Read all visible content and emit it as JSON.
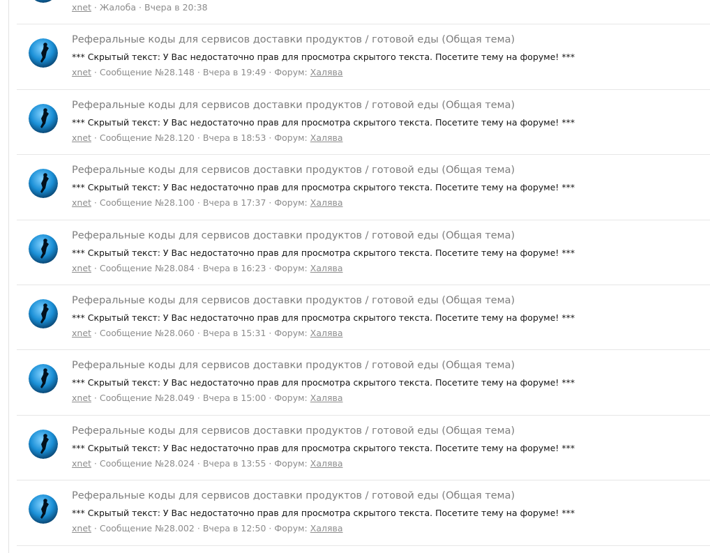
{
  "top_item": {
    "author": "xnet",
    "type": "Жалоба",
    "time": "Вчера в 20:38"
  },
  "labels": {
    "message_prefix": "Сообщение №",
    "forum_prefix": "Форум:"
  },
  "posts": [
    {
      "title": "Реферальные коды для сервисов доставки продуктов / готовой еды (Общая тема)",
      "snippet": "*** Скрытый текст: У Вас недостаточно прав для просмотра скрытого текста. Посетите тему на форуме! ***",
      "author": "xnet",
      "message_num": "28.148",
      "time": "Вчера в 19:49",
      "forum": "Халява"
    },
    {
      "title": "Реферальные коды для сервисов доставки продуктов / готовой еды (Общая тема)",
      "snippet": "*** Скрытый текст: У Вас недостаточно прав для просмотра скрытого текста. Посетите тему на форуме! ***",
      "author": "xnet",
      "message_num": "28.120",
      "time": "Вчера в 18:53",
      "forum": "Халява"
    },
    {
      "title": "Реферальные коды для сервисов доставки продуктов / готовой еды (Общая тема)",
      "snippet": "*** Скрытый текст: У Вас недостаточно прав для просмотра скрытого текста. Посетите тему на форуме! ***",
      "author": "xnet",
      "message_num": "28.100",
      "time": "Вчера в 17:37",
      "forum": "Халява"
    },
    {
      "title": "Реферальные коды для сервисов доставки продуктов / готовой еды (Общая тема)",
      "snippet": "*** Скрытый текст: У Вас недостаточно прав для просмотра скрытого текста. Посетите тему на форуме! ***",
      "author": "xnet",
      "message_num": "28.084",
      "time": "Вчера в 16:23",
      "forum": "Халява"
    },
    {
      "title": "Реферальные коды для сервисов доставки продуктов / готовой еды (Общая тема)",
      "snippet": "*** Скрытый текст: У Вас недостаточно прав для просмотра скрытого текста. Посетите тему на форуме! ***",
      "author": "xnet",
      "message_num": "28.060",
      "time": "Вчера в 15:31",
      "forum": "Халява"
    },
    {
      "title": "Реферальные коды для сервисов доставки продуктов / готовой еды (Общая тема)",
      "snippet": "*** Скрытый текст: У Вас недостаточно прав для просмотра скрытого текста. Посетите тему на форуме! ***",
      "author": "xnet",
      "message_num": "28.049",
      "time": "Вчера в 15:00",
      "forum": "Халява"
    },
    {
      "title": "Реферальные коды для сервисов доставки продуктов / готовой еды (Общая тема)",
      "snippet": "*** Скрытый текст: У Вас недостаточно прав для просмотра скрытого текста. Посетите тему на форуме! ***",
      "author": "xnet",
      "message_num": "28.024",
      "time": "Вчера в 13:55",
      "forum": "Халява"
    },
    {
      "title": "Реферальные коды для сервисов доставки продуктов / готовой еды (Общая тема)",
      "snippet": "*** Скрытый текст: У Вас недостаточно прав для просмотра скрытого текста. Посетите тему на форуме! ***",
      "author": "xnet",
      "message_num": "28.002",
      "time": "Вчера в 12:50",
      "forum": "Халява"
    }
  ],
  "colors": {
    "title": "#7d7d7d",
    "snippet": "#141414",
    "meta": "#8c8c8c",
    "divider": "#e6e6e6",
    "avatar": "#1a8fd6"
  },
  "avatar_icon": "diver-icon"
}
